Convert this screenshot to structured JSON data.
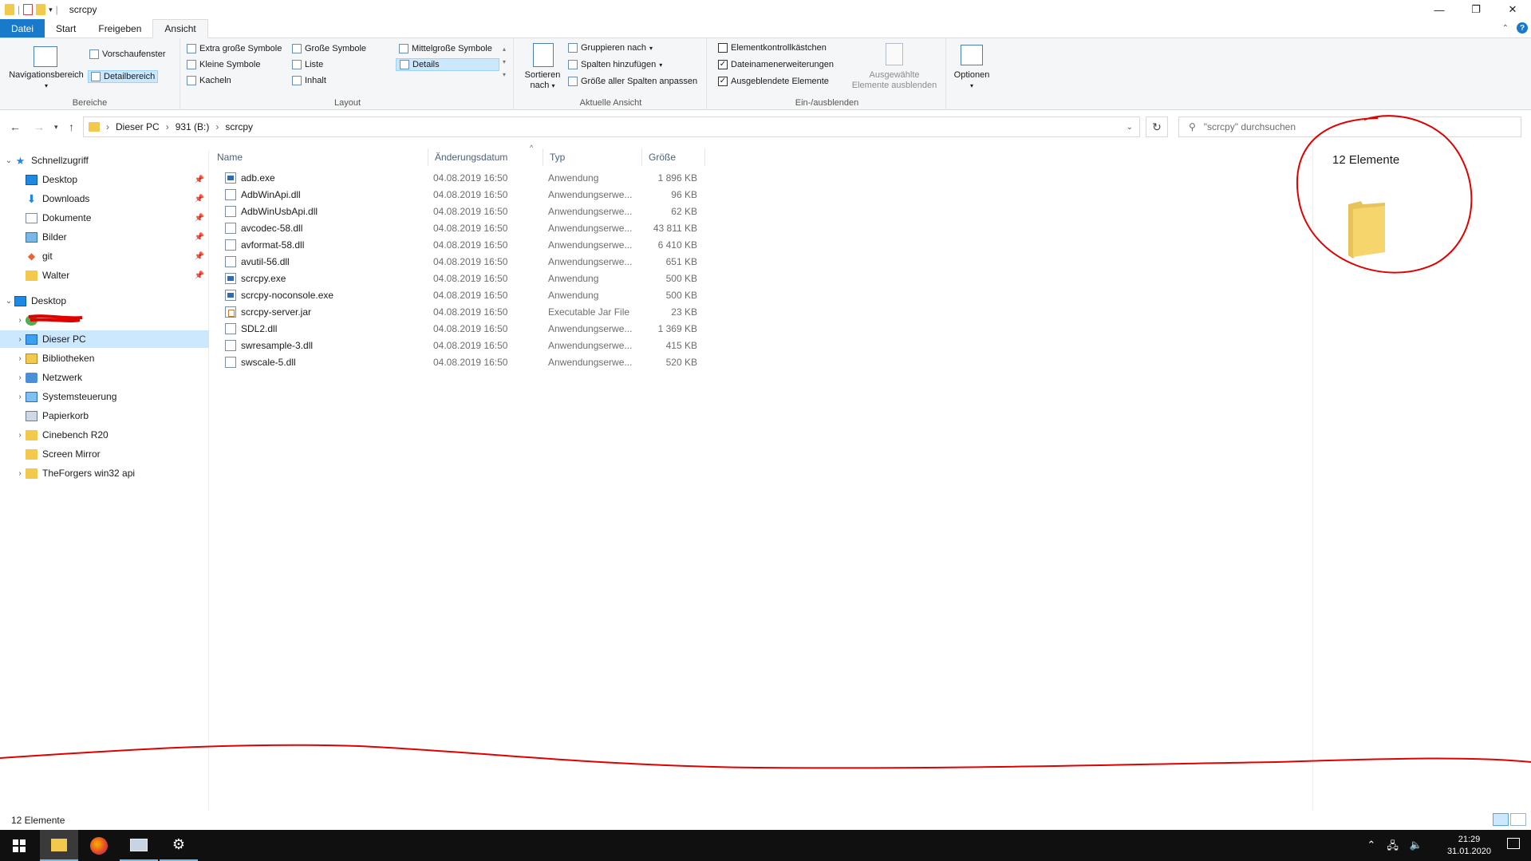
{
  "window": {
    "title": "scrcpy"
  },
  "ribbon_tabs": [
    {
      "label": "Datei"
    },
    {
      "label": "Start"
    },
    {
      "label": "Freigeben"
    },
    {
      "label": "Ansicht"
    }
  ],
  "ribbon": {
    "bereiche": {
      "navigationsbereich": "Navigationsbereich",
      "vorschaufenster": "Vorschaufenster",
      "detailbereich": "Detailbereich",
      "label": "Bereiche"
    },
    "layout": {
      "items": [
        "Extra große Symbole",
        "Große Symbole",
        "Mittelgroße Symbole",
        "Kleine Symbole",
        "Liste",
        "Details",
        "Kacheln",
        "Inhalt"
      ],
      "selected": "Details",
      "label": "Layout"
    },
    "aktuelle_ansicht": {
      "sortieren_line1": "Sortieren",
      "sortieren_line2": "nach",
      "gruppieren": "Gruppieren nach",
      "spalten": "Spalten hinzufügen",
      "groesse": "Größe aller Spalten anpassen",
      "label": "Aktuelle Ansicht"
    },
    "ein_ausblenden": {
      "checkboxes": [
        {
          "label": "Elementkontrollkästchen",
          "checked": false
        },
        {
          "label": "Dateinamenerweiterungen",
          "checked": true
        },
        {
          "label": "Ausgeblendete Elemente",
          "checked": true
        }
      ],
      "ausgewaehlte_line1": "Ausgewählte",
      "ausgewaehlte_line2": "Elemente ausblenden",
      "label": "Ein-/ausblenden"
    },
    "optionen": {
      "label": "Optionen"
    }
  },
  "address": {
    "path": [
      "Dieser PC",
      "931 (B:)",
      "scrcpy"
    ],
    "search_placeholder": "\"scrcpy\" durchsuchen"
  },
  "sidebar": {
    "quick_access": "Schnellzugriff",
    "quick_items": [
      "Desktop",
      "Downloads",
      "Dokumente",
      "Bilder",
      "git",
      "Walter"
    ],
    "desktop": "Desktop",
    "tree_items": [
      "Dieser PC",
      "Bibliotheken",
      "Netzwerk",
      "Systemsteuerung",
      "Papierkorb",
      "Cinebench R20",
      "Screen Mirror",
      "TheForgers win32 api"
    ]
  },
  "columns": {
    "name": "Name",
    "date": "Änderungsdatum",
    "type": "Typ",
    "size": "Größe"
  },
  "files": [
    {
      "name": "adb.exe",
      "date": "04.08.2019 16:50",
      "type": "Anwendung",
      "size": "1 896 KB",
      "icon": "exe"
    },
    {
      "name": "AdbWinApi.dll",
      "date": "04.08.2019 16:50",
      "type": "Anwendungserwe...",
      "size": "96 KB",
      "icon": "dll"
    },
    {
      "name": "AdbWinUsbApi.dll",
      "date": "04.08.2019 16:50",
      "type": "Anwendungserwe...",
      "size": "62 KB",
      "icon": "dll"
    },
    {
      "name": "avcodec-58.dll",
      "date": "04.08.2019 16:50",
      "type": "Anwendungserwe...",
      "size": "43 811 KB",
      "icon": "dll"
    },
    {
      "name": "avformat-58.dll",
      "date": "04.08.2019 16:50",
      "type": "Anwendungserwe...",
      "size": "6 410 KB",
      "icon": "dll"
    },
    {
      "name": "avutil-56.dll",
      "date": "04.08.2019 16:50",
      "type": "Anwendungserwe...",
      "size": "651 KB",
      "icon": "dll"
    },
    {
      "name": "scrcpy.exe",
      "date": "04.08.2019 16:50",
      "type": "Anwendung",
      "size": "500 KB",
      "icon": "exe"
    },
    {
      "name": "scrcpy-noconsole.exe",
      "date": "04.08.2019 16:50",
      "type": "Anwendung",
      "size": "500 KB",
      "icon": "exe"
    },
    {
      "name": "scrcpy-server.jar",
      "date": "04.08.2019 16:50",
      "type": "Executable Jar File",
      "size": "23 KB",
      "icon": "jar"
    },
    {
      "name": "SDL2.dll",
      "date": "04.08.2019 16:50",
      "type": "Anwendungserwe...",
      "size": "1 369 KB",
      "icon": "dll"
    },
    {
      "name": "swresample-3.dll",
      "date": "04.08.2019 16:50",
      "type": "Anwendungserwe...",
      "size": "415 KB",
      "icon": "dll"
    },
    {
      "name": "swscale-5.dll",
      "date": "04.08.2019 16:50",
      "type": "Anwendungserwe...",
      "size": "520 KB",
      "icon": "dll"
    }
  ],
  "details_pane": {
    "count": "12 Elemente"
  },
  "status": {
    "count": "12 Elemente"
  },
  "taskbar": {
    "time": "21:29",
    "date": "31.01.2020"
  },
  "colors": {
    "accent": "#1979ca",
    "selection": "#cce8ff",
    "annotation": "#e00000"
  }
}
